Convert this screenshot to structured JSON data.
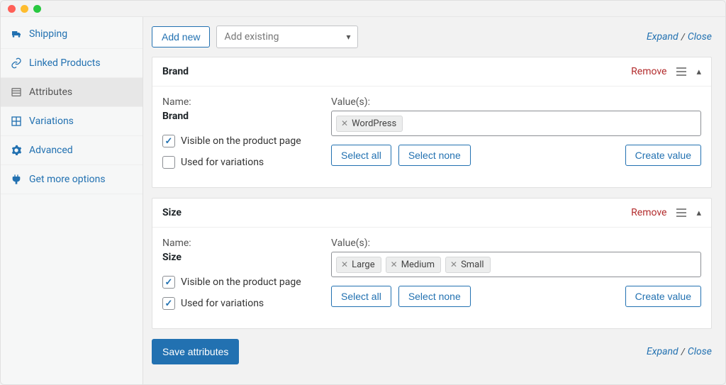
{
  "sidebar": {
    "items": [
      {
        "label": "Shipping",
        "icon": "truck"
      },
      {
        "label": "Linked Products",
        "icon": "link"
      },
      {
        "label": "Attributes",
        "icon": "list"
      },
      {
        "label": "Variations",
        "icon": "grid"
      },
      {
        "label": "Advanced",
        "icon": "gear"
      },
      {
        "label": "Get more options",
        "icon": "plugin"
      }
    ]
  },
  "toolbar": {
    "add_new": "Add new",
    "add_existing_placeholder": "Add existing",
    "expand": "Expand",
    "divider": "/",
    "close": "Close"
  },
  "attributes": [
    {
      "title": "Brand",
      "remove": "Remove",
      "name_label": "Name:",
      "name_value": "Brand",
      "values_label": "Value(s):",
      "visible_label": "Visible on the product page",
      "visible_checked": true,
      "variations_label": "Used for variations",
      "variations_checked": false,
      "select_all": "Select all",
      "select_none": "Select none",
      "create_value": "Create value",
      "tags": [
        "WordPress"
      ]
    },
    {
      "title": "Size",
      "remove": "Remove",
      "name_label": "Name:",
      "name_value": "Size",
      "values_label": "Value(s):",
      "visible_label": "Visible on the product page",
      "visible_checked": true,
      "variations_label": "Used for variations",
      "variations_checked": true,
      "select_all": "Select all",
      "select_none": "Select none",
      "create_value": "Create value",
      "tags": [
        "Large",
        "Medium",
        "Small"
      ]
    }
  ],
  "footer": {
    "save": "Save attributes",
    "expand": "Expand",
    "divider": "/",
    "close": "Close"
  }
}
